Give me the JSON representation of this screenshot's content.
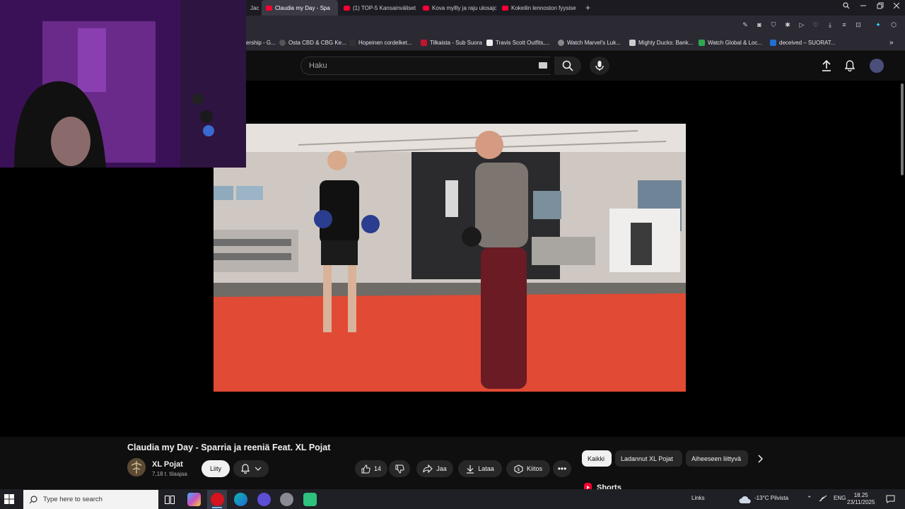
{
  "browser": {
    "tabs": [
      {
        "label": "Jac",
        "active": false
      },
      {
        "label": "Claudia my Day - Spa",
        "active": true
      },
      {
        "label": "(1) TOP-5 Kansainväliset u",
        "active": false
      },
      {
        "label": "Kova myllly ja raju ulosajo",
        "active": false
      },
      {
        "label": "Kokeilin lennoston fyysise",
        "active": false
      }
    ],
    "new_tab": "+",
    "bookmarks": [
      "ership - G...",
      "Osta CBD & CBG Ke...",
      "Hopeinen cordelket...",
      "Tilkaista - Sub Suora",
      "Travis Scott Outfits,...",
      "Watch Marvel's Luk...",
      "Mighty Ducks: Bank...",
      "Watch Global & Loc...",
      "deceived – SUORAT..."
    ]
  },
  "youtube": {
    "search_placeholder": "Haku",
    "video": {
      "title": "Claudia my Day - Sparria ja reeniä Feat. XL Pojat",
      "channel": "XL Pojat",
      "subscribers": "7,18 t. tilaajaa",
      "join_label": "Liity",
      "like_count": "14",
      "share_label": "Jaa",
      "download_label": "Lataa",
      "thanks_label": "Kiitos"
    },
    "chips": [
      "Kaikki",
      "Ladannut XL Pojat",
      "Aiheeseen liittyvä"
    ],
    "shorts_label": "Shorts"
  },
  "taskbar": {
    "search_placeholder": "Type here to search",
    "links_label": "Links",
    "weather": "-13°C Pilvista",
    "language": "ENG",
    "time": "18.25",
    "date": "23/11/2025"
  },
  "colors": {
    "brand_red": "#ff0033",
    "background": "#0f0f0f",
    "chip_bg": "#272727"
  }
}
